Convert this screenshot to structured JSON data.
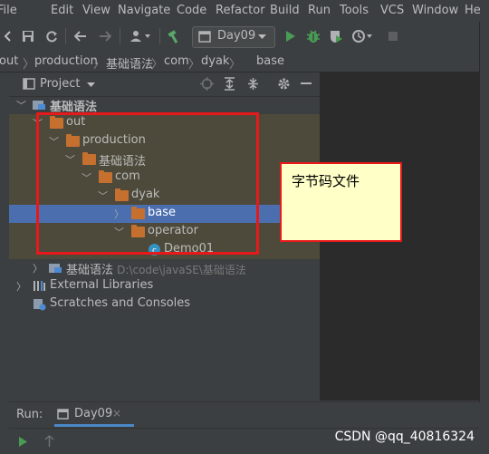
{
  "menu": [
    "File",
    "Edit",
    "View",
    "Navigate",
    "Code",
    "Refactor",
    "Build",
    "Run",
    "Tools",
    "VCS",
    "Window",
    "He"
  ],
  "toolbar": {
    "run_config": "Day09"
  },
  "breadcrumb": [
    "out",
    "production",
    "基础语法",
    "com",
    "dyak",
    "base"
  ],
  "project_panel": {
    "title": "Project"
  },
  "tree": [
    {
      "label": "基础语法",
      "path": ""
    },
    {
      "label": "out",
      "path": ""
    },
    {
      "label": "production",
      "path": ""
    },
    {
      "label": "基础语法",
      "path": ""
    },
    {
      "label": "com",
      "path": ""
    },
    {
      "label": "dyak",
      "path": ""
    },
    {
      "label": "base",
      "path": ""
    },
    {
      "label": "operator",
      "path": ""
    },
    {
      "label": "Demo01",
      "path": ""
    },
    {
      "label": "基础语法",
      "path": "D:\\code\\javaSE\\基础语法"
    },
    {
      "label": "External Libraries",
      "path": ""
    },
    {
      "label": "Scratches and Consoles",
      "path": ""
    }
  ],
  "annotation": {
    "note": "字节码文件"
  },
  "run_panel": {
    "label": "Run:",
    "tab": "Day09"
  },
  "watermark": "CSDN @qq_40816324",
  "colors": {
    "background": "#3c3f41",
    "selection": "#4b6eaf",
    "folder": "#c6702f",
    "annotation_border": "#e8191a",
    "note_bg": "#ffffc8"
  }
}
